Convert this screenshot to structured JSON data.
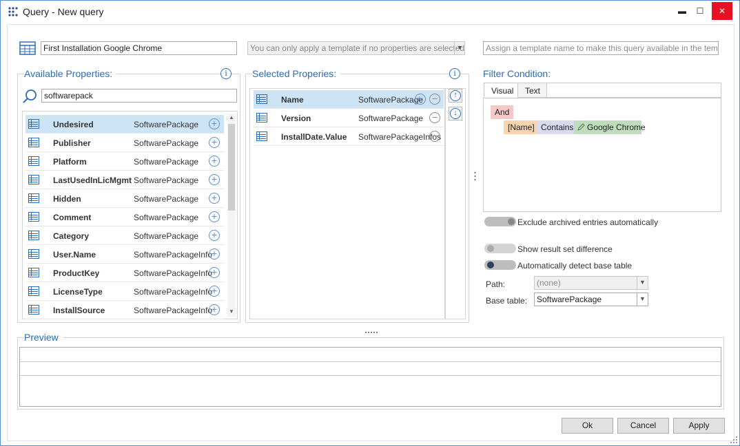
{
  "window": {
    "title": "Query - New query",
    "minimize": "▬",
    "maximize": "☐",
    "close": "✕"
  },
  "top": {
    "query_name": "First Installation Google Chrome",
    "template_select": "You can only apply a template if no properties are selected.",
    "template_name_placeholder": "Assign a template name to make this query available in the template list"
  },
  "available": {
    "title": "Available Properties:",
    "search_value": "softwarepack",
    "rows": [
      {
        "name": "Undesired",
        "type": "SoftwarePackage",
        "selected": true
      },
      {
        "name": "Publisher",
        "type": "SoftwarePackage"
      },
      {
        "name": "Platform",
        "type": "SoftwarePackage"
      },
      {
        "name": "LastUsedInLicMgmt",
        "type": "SoftwarePackage"
      },
      {
        "name": "Hidden",
        "type": "SoftwarePackage"
      },
      {
        "name": "Comment",
        "type": "SoftwarePackage"
      },
      {
        "name": "Category",
        "type": "SoftwarePackage"
      },
      {
        "name": "User.Name",
        "type": "SoftwarePackageInfo"
      },
      {
        "name": "ProductKey",
        "type": "SoftwarePackageInfo"
      },
      {
        "name": "LicenseType",
        "type": "SoftwarePackageInfo"
      },
      {
        "name": "InstallSource",
        "type": "SoftwarePackageInfo"
      }
    ]
  },
  "selected": {
    "title": "Selected Properies:",
    "rows": [
      {
        "name": "Name",
        "type": "SoftwarePackage",
        "selected": true
      },
      {
        "name": "Version",
        "type": "SoftwarePackage"
      },
      {
        "name": "InstallDate.Value",
        "type": "SoftwarePackageInfos"
      }
    ]
  },
  "filter": {
    "title": "Filter Condition:",
    "tabs": [
      "Visual",
      "Text"
    ],
    "and_label": "And",
    "field": "[Name]",
    "operator": "Contains",
    "value": "Google Chrome"
  },
  "options": {
    "exclude_archived": "Exclude archived entries automatically",
    "show_difference": "Show result set difference",
    "detect_base": "Automatically detect base table",
    "path_label": "Path:",
    "path_value": "(none)",
    "base_label": "Base table:",
    "base_value": "SoftwarePackage"
  },
  "preview": {
    "title": "Preview"
  },
  "buttons": {
    "ok": "Ok",
    "cancel": "Cancel",
    "apply": "Apply"
  },
  "colors": {
    "accent": "#2a6db6",
    "selected_row": "#cde3f6",
    "and_chip": "#f6c9c9",
    "field_chip": "#f8d4b0",
    "op_chip": "#d9d9ef",
    "value_chip": "#bfdcbc"
  }
}
